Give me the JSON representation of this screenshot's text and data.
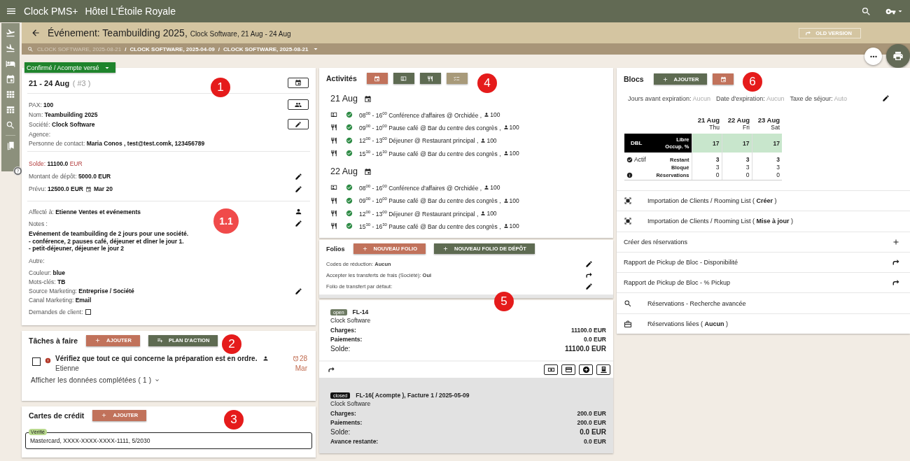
{
  "app": {
    "title": "Clock PMS+",
    "hotel": "Hôtel L'Étoile Royale"
  },
  "header": {
    "title": "Événement: Teambuilding 2025,",
    "subtitle": "Clock Software, 21 Aug - 24 Aug",
    "old_version": "OLD VERSION",
    "separator": "/",
    "breadcrumbs": [
      {
        "label": "CLOCK SOFTWARE, 2025-08-21",
        "disabled": true
      },
      {
        "label": "CLOCK SOFTWARE, 2025-04-09",
        "disabled": false
      },
      {
        "label": "CLOCK SOFTWARE, 2025-08-21",
        "disabled": false
      }
    ]
  },
  "status": "Confirmé / Acompte versé",
  "event": {
    "marker": "1",
    "dates": "21 - 24 Aug",
    "number": "( #3 )",
    "sections": [
      [
        {
          "text": "PAX: **100**",
          "kind": "team"
        },
        {
          "text": "Nom: **Teambuilding 2025**",
          "kind": "plain"
        },
        {
          "text": "Société: **Clock Software**",
          "kind": "edit-box"
        },
        {
          "text": "Agence:",
          "kind": "plain"
        },
        {
          "text": "Personne de contact: **Maria Conos , test@test.comk, 123456789**",
          "kind": "plain"
        }
      ],
      [
        {
          "text": "Solde: **11100.0** EUR",
          "kind": "alert"
        },
        {
          "text": "Montant de dépôt: **5000.0 EUR**",
          "kind": "edit"
        },
        {
          "text": "Prévu: **12500.0 EUR**",
          "date": "Mar 20",
          "kind": "edit"
        }
      ]
    ],
    "marker2": "1.1",
    "assigned": {
      "text": "Affecté à: **Etienne  Ventes et evénements**",
      "kind": "person"
    },
    "notes_label": "Notes :",
    "notes_lines": [
      "Evénement de teambuilding de 2 jours pour une société.",
      "- conférence, 2 pauses café, déjeuner et dîner le jour 1.",
      "- petit-déjeuner, déjeuner le jour 2"
    ],
    "other": [
      {
        "text": "Autre:",
        "kind": "plain"
      },
      {
        "text": "Couleur: **blue**",
        "kind": "plain"
      },
      {
        "text": "Mots-clés: **TB**",
        "kind": "plain"
      },
      {
        "text": "Source Marketing: **Entreprise / Société**",
        "kind": "edit"
      },
      {
        "text": "Canal Marketing: **Email**",
        "kind": "plain"
      }
    ],
    "requests": {
      "text": "Demandes de client:",
      "checked": false
    }
  },
  "tasks": {
    "marker": "2",
    "title": "Tâches à faire",
    "buttons": [
      {
        "label": "AJOUTER",
        "kind": "add"
      },
      {
        "label": "PLAN D'ACTION",
        "kind": "plan"
      }
    ],
    "items": [
      {
        "title": "Vérifiez que tout ce qui concerne la préparation est en ordre.",
        "assignee": "Etienne",
        "due_day": "28",
        "due_month": "Mar",
        "checked": false
      }
    ],
    "show_completed": "Afficher les données complétées ( 1 )"
  },
  "credit_cards": {
    "marker": "3",
    "title": "Cartes de crédit",
    "button": "AJOUTER",
    "cards": [
      {
        "tag": "Vérifié",
        "text": "Mastercard, XXXX-XXXX-XXXX-1111, 5/2030"
      }
    ]
  },
  "activities": {
    "marker": "4",
    "title": "Activités",
    "days": [
      {
        "date": "21 Aug",
        "items": [
          {
            "kind": "meeting",
            "confirmed": true,
            "time": "08$^{00}$ - 16$^{00}$",
            "text": "Conférence d'affaires @ Orchidée ,",
            "pax": "100"
          },
          {
            "kind": "food",
            "confirmed": true,
            "time": "09$^{00}$ - 10$^{00}$",
            "text": "Pause café @ Bar du centre des congrès ,",
            "pax": "100"
          },
          {
            "kind": "food",
            "confirmed": true,
            "time": "12$^{00}$ - 13$^{00}$",
            "text": "Déjeuner @ Restaurant principal ,",
            "pax": "100"
          },
          {
            "kind": "food",
            "confirmed": true,
            "time": "15$^{30}$ - 16$^{30}$",
            "text": "Pause café @ Bar du centre des congrès ,",
            "pax": "100"
          }
        ]
      },
      {
        "date": "22 Aug",
        "items": [
          {
            "kind": "meeting",
            "confirmed": true,
            "time": "08$^{00}$ - 16$^{00}$",
            "text": "Conférence d'affaires @ Orchidée ,",
            "pax": "100"
          },
          {
            "kind": "food",
            "confirmed": true,
            "time": "09$^{00}$ - 10$^{00}$",
            "text": "Pause café @ Bar du centre des congrès ,",
            "pax": "100"
          },
          {
            "kind": "food",
            "confirmed": true,
            "time": "12$^{00}$ - 13$^{00}$",
            "text": "Déjeuner @ Restaurant principal ,",
            "pax": "100"
          },
          {
            "kind": "food",
            "confirmed": true,
            "time": "15$^{30}$ - 16$^{30}$",
            "text": "Pause café @ Bar du centre des congrès ,",
            "pax": "100"
          }
        ]
      }
    ]
  },
  "folios": {
    "marker": "5",
    "title": "Folios",
    "buttons": [
      {
        "label": "NOUVEAU FOLIO",
        "kind": "primary"
      },
      {
        "label": "NOUVEAU FOLIO DE DÉPÔT",
        "kind": "secondary"
      }
    ],
    "settings": [
      {
        "text": "Codes de réduction: **Aucun**",
        "kind": "edit"
      },
      {
        "text": "Accepter les transferts de frais (Société): **Oui**",
        "kind": "forward"
      },
      {
        "text": "Folio de transfert par défaut:",
        "kind": "edit"
      }
    ],
    "list": [
      {
        "closed": false,
        "badge": "open",
        "title": "FL-14",
        "company": "Clock Software",
        "rows": [
          {
            "label": "Charges:",
            "value": "11100.0 EUR",
            "kind": "plain"
          },
          {
            "label": "Paiements:",
            "value": "0.0 EUR",
            "kind": "plain"
          },
          {
            "label": "Solde:",
            "value": "11100.0 EUR",
            "kind": "total"
          }
        ]
      },
      {
        "closed": true,
        "badge": "closed",
        "title": "FL-16( Acompte ), Facture 1 / 2025-05-09",
        "company": "Clock Software",
        "rows": [
          {
            "label": "Charges:",
            "value": "200.0 EUR",
            "kind": "plain"
          },
          {
            "label": "Paiements:",
            "value": "200.0 EUR",
            "kind": "plain"
          },
          {
            "label": "Solde:",
            "value": "0.0 EUR",
            "kind": "total"
          },
          {
            "label": "Avance restante:",
            "value": "0.0 EUR",
            "kind": "plain"
          }
        ]
      }
    ]
  },
  "blocks": {
    "marker": "6",
    "title": "Blocs",
    "button": "AJOUTER",
    "info": [
      {
        "label": "Jours avant expiration:",
        "value": "Aucun"
      },
      {
        "label": "Date d'expiration:",
        "value": "Aucun"
      },
      {
        "label": "Taxe de séjour:",
        "value": "Auto"
      }
    ],
    "days": [
      {
        "date": "21 Aug",
        "day": "Thu"
      },
      {
        "date": "22 Aug",
        "day": "Fri"
      },
      {
        "date": "23 Aug",
        "day": "Sat"
      }
    ],
    "room": {
      "type": "DBL",
      "label1": "Libre",
      "label2": "Occup. %",
      "values": [
        "17",
        "17",
        "17"
      ],
      "status": "Actif",
      "rows": [
        {
          "label": "Restant",
          "values": [
            "3",
            "3",
            "3"
          ],
          "bold": true
        },
        {
          "label": "Bloqué",
          "values": [
            "3",
            "3",
            "3"
          ],
          "bold": false
        },
        {
          "label": "Réservations",
          "values": [
            "0",
            "0",
            "0"
          ],
          "bold": false
        }
      ]
    },
    "links": [
      {
        "kind": "import",
        "text": "Importation de Clients / Rooming List ( **Créer** )"
      },
      {
        "kind": "import",
        "text": "Importation de Clients / Rooming List ( **Mise à jour** )"
      },
      {
        "kind": "plus",
        "text": "Créer des réservations"
      },
      {
        "kind": "forward",
        "text": "Rapport de Pickup de Bloc - Disponibilité"
      },
      {
        "kind": "forward",
        "text": "Rapport de Pickup de Bloc - % Pickup"
      },
      {
        "kind": "search",
        "text": "Réservations - Recherche avancée"
      },
      {
        "kind": "briefcase",
        "text": "Réservations liées ( **Aucun** )"
      }
    ]
  }
}
